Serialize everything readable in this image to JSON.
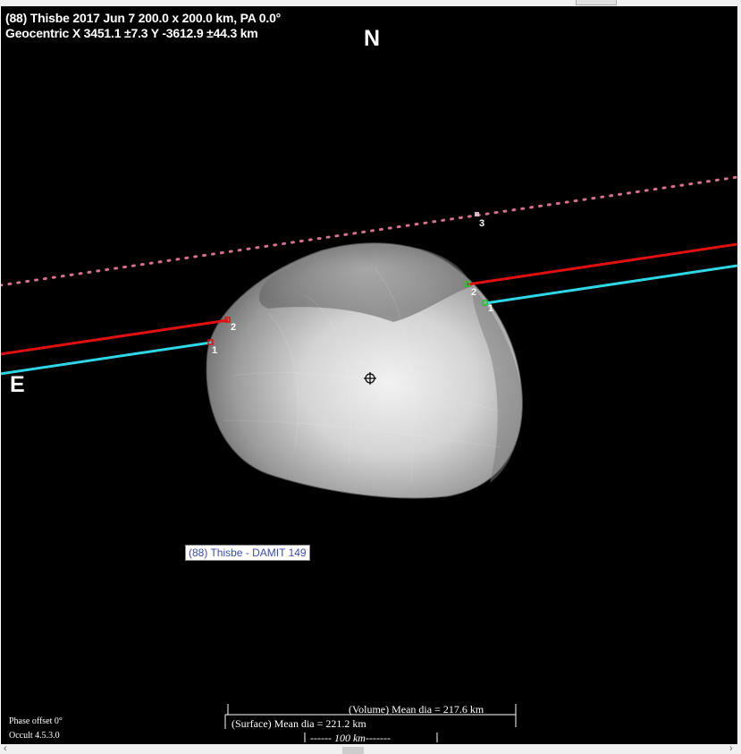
{
  "header": {
    "line1": "(88) Thisbe  2017 Jun 7   200.0 x 200.0 km, PA 0.0°",
    "line2": "Geocentric  X  3451.1 ±7.3  Y -3612.9 ±44.3 km"
  },
  "directions": {
    "north": "N",
    "east": "E"
  },
  "chords": {
    "west_lower": "1",
    "west_upper": "2",
    "east_lower": "1",
    "east_upper": "2",
    "miss": "3"
  },
  "colors": {
    "chord1": "#2fd6e6",
    "chord2": "#e01010",
    "miss": "#d6708c",
    "background": "#000000"
  },
  "model_label": "(88) Thisbe - DAMIT 149",
  "footer": {
    "phase_offset": "Phase offset 0°",
    "version": "Occult 4.5.3.0",
    "volume_dia": "(Volume) Mean dia = 217.6 km",
    "surface_dia": "(Surface) Mean dia = 221.2 km",
    "scale": "100 km"
  },
  "icons": {
    "center": "crosshair-icon",
    "scroll_left": "chevron-left-icon",
    "scroll_right": "chevron-right-icon"
  }
}
